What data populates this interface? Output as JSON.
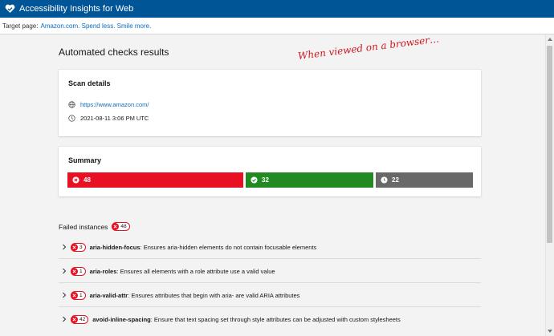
{
  "app": {
    "title": "Accessibility Insights for Web",
    "logo_icon": "heart-check-icon"
  },
  "target": {
    "label": "Target page:",
    "link_text": "Amazon.com. Spend less. Smile more."
  },
  "page": {
    "title": "Automated checks results",
    "annotation": "When viewed on a browser…"
  },
  "scan_details": {
    "title": "Scan details",
    "url": "https://www.amazon.com/",
    "url_icon": "globe-icon",
    "timestamp": "2021-08-11 3:06 PM UTC",
    "timestamp_icon": "clock-icon"
  },
  "summary": {
    "title": "Summary",
    "failed_count": "48",
    "passed_count": "32",
    "not_applicable_count": "22",
    "colors": {
      "failed": "#e81123",
      "passed": "#228a22",
      "not_applicable": "#686868"
    }
  },
  "failed_instances": {
    "title": "Failed instances",
    "count": "48",
    "rules": [
      {
        "id": "aria-hidden-focus",
        "count": "3",
        "description": ": Ensures aria-hidden elements do not contain focusable elements"
      },
      {
        "id": "aria-roles",
        "count": "1",
        "description": ": Ensures all elements with a role attribute use a valid value"
      },
      {
        "id": "aria-valid-attr",
        "count": "1",
        "description": ": Ensures attributes that begin with aria- are valid ARIA attributes"
      },
      {
        "id": "avoid-inline-spacing",
        "count": "42",
        "description": ": Ensure that text spacing set through style attributes can be adjusted with custom stylesheets"
      }
    ]
  },
  "colors": {
    "header": "#005596",
    "link": "#0a6abf",
    "accent_red": "#e81123"
  }
}
